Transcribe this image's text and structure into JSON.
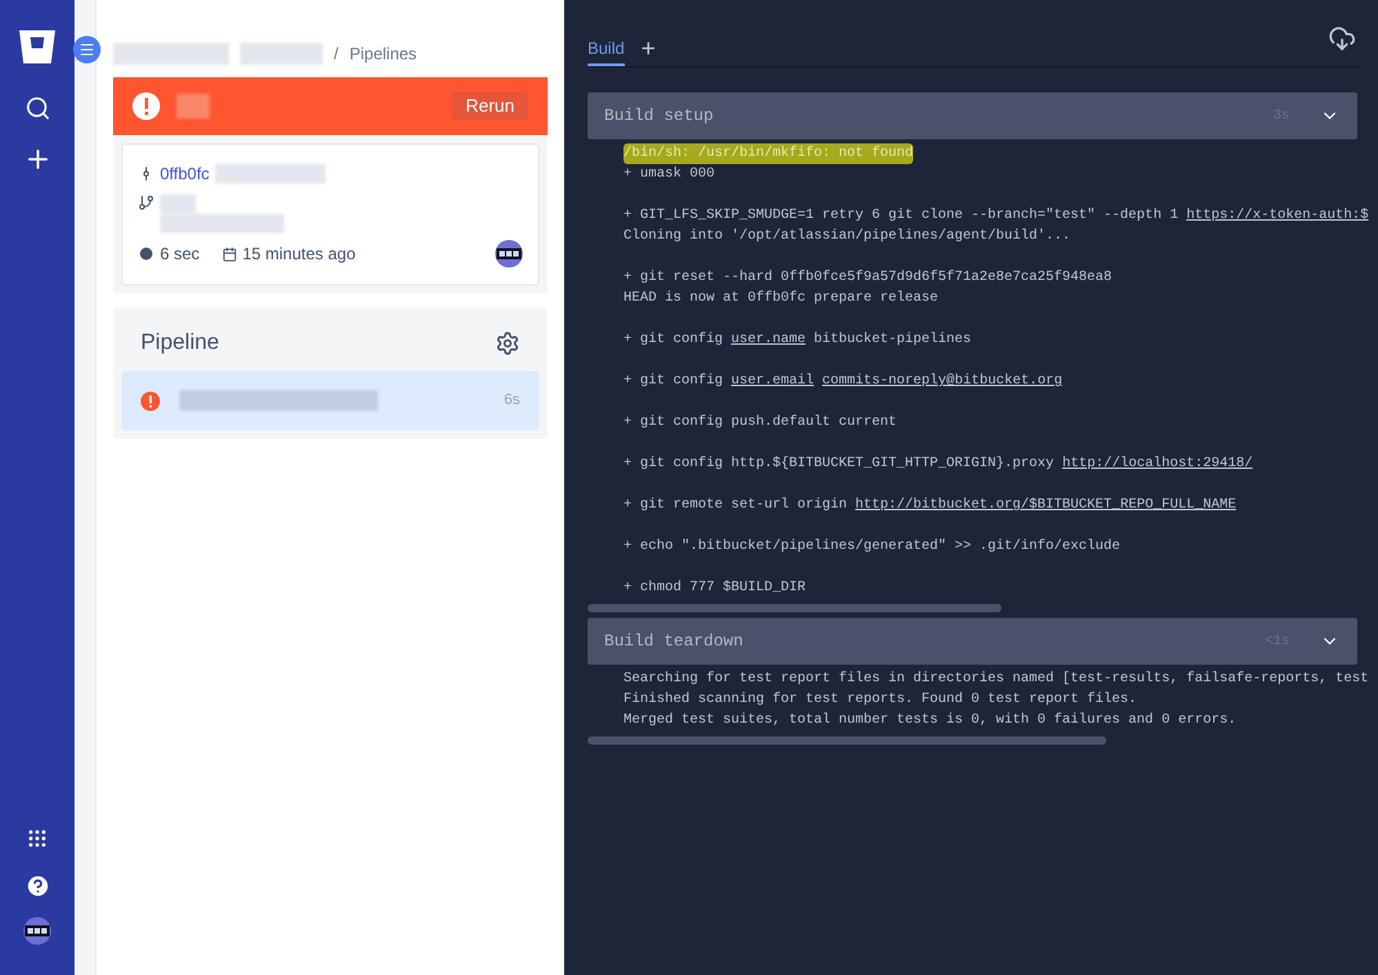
{
  "breadcrumb": {
    "current": "Pipelines",
    "separator": "/"
  },
  "run": {
    "kind": "error",
    "rerun": "Rerun",
    "commit": "0ffb0fc",
    "duration": "6 sec",
    "time": "15 minutes ago"
  },
  "pipeline": {
    "title": "Pipeline",
    "steps": [
      {
        "kind": "error",
        "selected": true,
        "duration": "6s"
      }
    ]
  },
  "tabs": [
    {
      "label": "Build",
      "selected": true
    }
  ],
  "add_tab": "+",
  "log_sections": [
    {
      "title": "Build setup",
      "duration": "3s",
      "expanded": true,
      "blocks": [
        [
          {
            "highlighted": true,
            "parts": [
              {
                "text": "/bin/sh: /usr/bin/mkfifo: not found",
                "link": false
              }
            ]
          },
          {
            "highlighted": false,
            "parts": [
              {
                "text": "+ umask 000",
                "link": false
              }
            ]
          }
        ],
        [
          {
            "highlighted": false,
            "parts": [
              {
                "text": "+ GIT_LFS_SKIP_SMUDGE=1 retry 6 git clone --branch=\"test\" --depth 1 ",
                "link": false
              },
              {
                "text": "https://x-token-auth:$",
                "link": true
              }
            ]
          },
          {
            "highlighted": false,
            "parts": [
              {
                "text": "Cloning into '/opt/atlassian/pipelines/agent/build'...",
                "link": false
              }
            ]
          }
        ],
        [
          {
            "highlighted": false,
            "parts": [
              {
                "text": "+ git reset --hard 0ffb0fce5f9a57d9d6f5f71a2e8e7ca25f948ea8",
                "link": false
              }
            ]
          },
          {
            "highlighted": false,
            "parts": [
              {
                "text": "HEAD is now at 0ffb0fc prepare release",
                "link": false
              }
            ]
          }
        ],
        [
          {
            "highlighted": false,
            "parts": [
              {
                "text": "+ git config ",
                "link": false
              },
              {
                "text": "user.name",
                "link": true
              },
              {
                "text": " bitbucket-pipelines",
                "link": false
              }
            ]
          }
        ],
        [
          {
            "highlighted": false,
            "parts": [
              {
                "text": "+ git config ",
                "link": false
              },
              {
                "text": "user.email",
                "link": true,
                "space_after": true
              },
              {
                "text": "commits-noreply@bitbucket.org",
                "link": true
              }
            ]
          }
        ],
        [
          {
            "highlighted": false,
            "parts": [
              {
                "text": "+ git config push.default current",
                "link": false
              }
            ]
          }
        ],
        [
          {
            "highlighted": false,
            "parts": [
              {
                "text": "+ git config http.${BITBUCKET_GIT_HTTP_ORIGIN}.proxy ",
                "link": false
              },
              {
                "text": "http://localhost:29418/",
                "link": true
              }
            ]
          }
        ],
        [
          {
            "highlighted": false,
            "parts": [
              {
                "text": "+ git remote set-url origin ",
                "link": false
              },
              {
                "text": "http://bitbucket.org/$BITBUCKET_REPO_FULL_NAME",
                "link": true
              }
            ]
          }
        ],
        [
          {
            "highlighted": false,
            "parts": [
              {
                "text": "+ echo \".bitbucket/pipelines/generated\" >> .git/info/exclude",
                "link": false
              }
            ]
          }
        ],
        [
          {
            "highlighted": false,
            "parts": [
              {
                "text": "+ chmod 777 $BUILD_DIR",
                "link": false
              }
            ]
          }
        ]
      ]
    },
    {
      "title": "Build teardown",
      "duration": "<1s",
      "expanded": true,
      "blocks": [
        [
          {
            "highlighted": false,
            "parts": [
              {
                "text": "Searching for test report files in directories named [test-results, failsafe-reports, test",
                "link": false
              }
            ]
          },
          {
            "highlighted": false,
            "parts": [
              {
                "text": "Finished scanning for test reports. Found 0 test report files.",
                "link": false
              }
            ]
          },
          {
            "highlighted": false,
            "parts": [
              {
                "text": "Merged test suites, total number tests is 0, with 0 failures and 0 errors.",
                "link": false
              }
            ]
          }
        ]
      ]
    }
  ]
}
